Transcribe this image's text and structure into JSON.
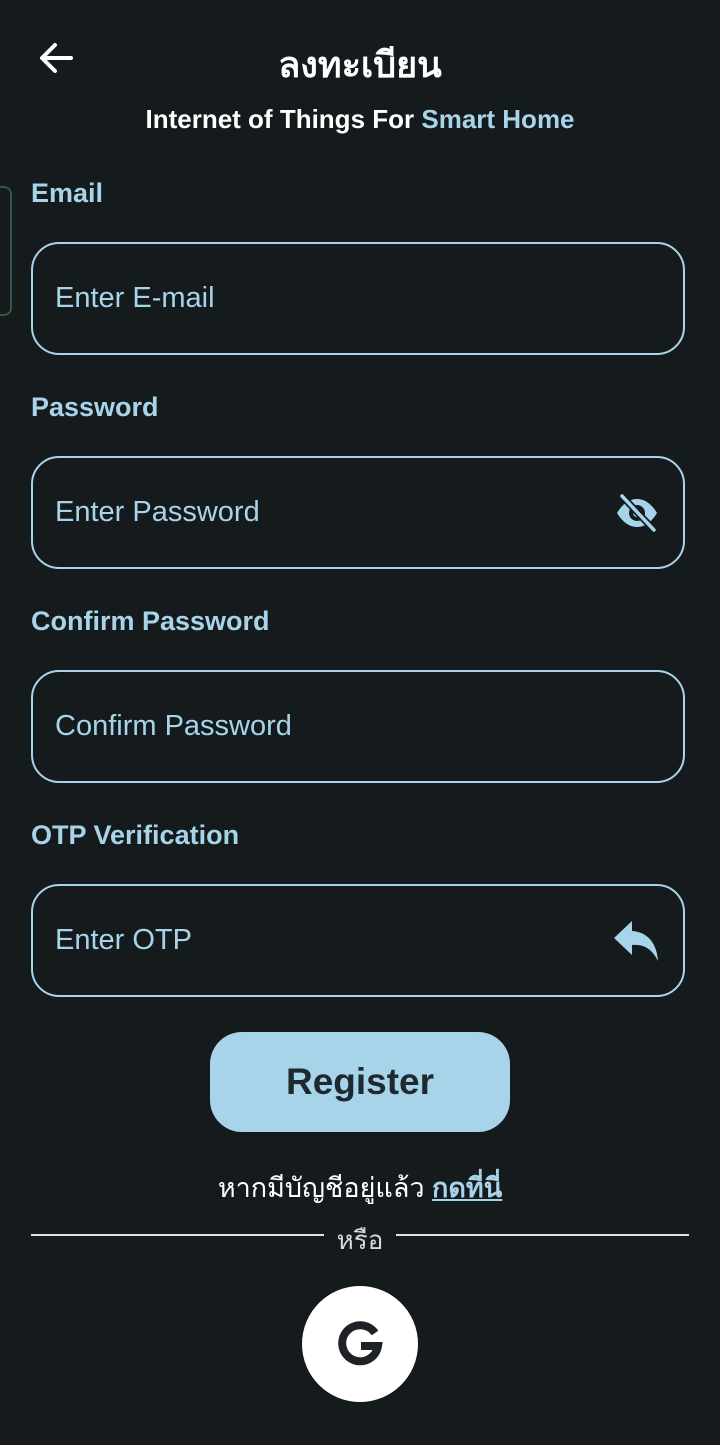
{
  "header": {
    "title": "ลงทะเบียน",
    "subtitle_main": "Internet of Things For ",
    "subtitle_accent": "Smart Home",
    "back_icon": "arrow-left-icon"
  },
  "form": {
    "email": {
      "label": "Email",
      "placeholder": "Enter E-mail"
    },
    "password": {
      "label": "Password",
      "placeholder": "Enter Password",
      "toggle_icon": "eye-off-icon"
    },
    "confirm_password": {
      "label": "Confirm Password",
      "placeholder": "Confirm Password"
    },
    "otp": {
      "label": "OTP Verification",
      "placeholder": "Enter OTP",
      "resend_icon": "reply-icon"
    }
  },
  "actions": {
    "register_label": "Register",
    "login_prompt": "หากมีบัญชีอยู่แล้ว ",
    "login_link": "กดที่นี่",
    "or_text": "หรือ",
    "google_icon": "google-icon"
  },
  "colors": {
    "background": "#151a1d",
    "accent": "#a8d4ea",
    "text_primary": "#ffffff",
    "button_text": "#1e2a30"
  }
}
